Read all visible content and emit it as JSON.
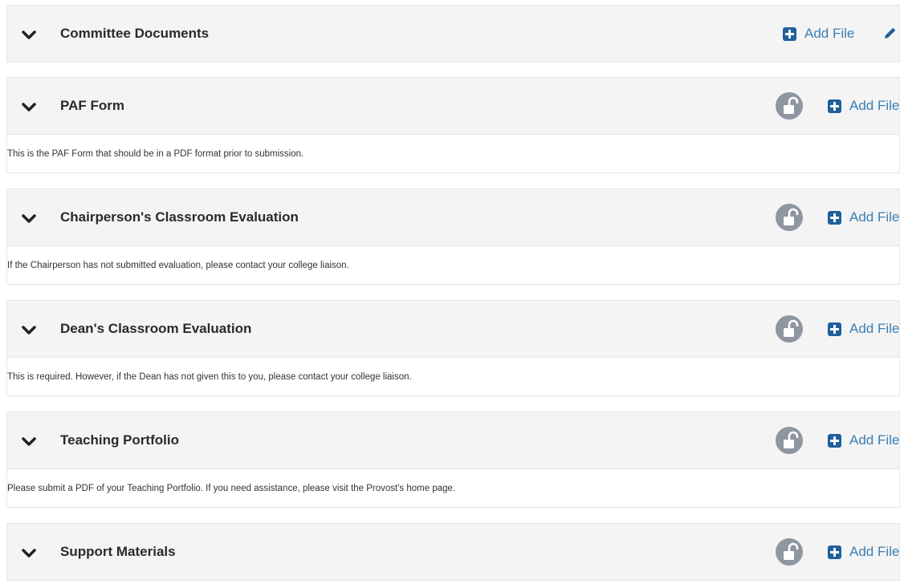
{
  "sections": [
    {
      "title": "Committee Documents",
      "add_file_label": "Add File",
      "has_lock": false,
      "has_edit": true,
      "description": ""
    },
    {
      "title": "PAF Form",
      "add_file_label": "Add File",
      "has_lock": true,
      "has_edit": false,
      "description": "This is the PAF Form that should be in a PDF format prior to submission."
    },
    {
      "title": "Chairperson's Classroom Evaluation",
      "add_file_label": "Add File",
      "has_lock": true,
      "has_edit": false,
      "description": "If the Chairperson has not submitted evaluation, please contact your college liaison."
    },
    {
      "title": "Dean's Classroom Evaluation",
      "add_file_label": "Add File",
      "has_lock": true,
      "has_edit": false,
      "description": "This is required. However, if the Dean has not given this to you, please contact your college liaison."
    },
    {
      "title": "Teaching Portfolio",
      "add_file_label": "Add File",
      "has_lock": true,
      "has_edit": false,
      "description": "Please submit a PDF of your Teaching Portfolio. If you need assistance, please visit the Provost's home page."
    },
    {
      "title": "Support Materials",
      "add_file_label": "Add File",
      "has_lock": true,
      "has_edit": false,
      "description": ""
    }
  ],
  "icons": {
    "toggle": "chevron-down-icon",
    "add": "plus-square-icon",
    "lock": "unlock-icon",
    "edit": "pencil-icon"
  },
  "colors": {
    "header_bg": "#f4f4f4",
    "link": "#3a7fb5",
    "plus_icon": "#1f5f9b",
    "lock_bg": "#8e96a1",
    "title_text": "#2a2a2a"
  }
}
